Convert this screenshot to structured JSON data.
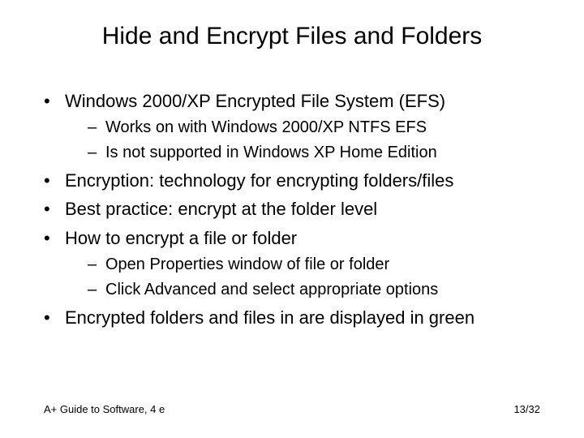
{
  "title": "Hide and Encrypt Files and Folders",
  "bullets": [
    {
      "text": "Windows 2000/XP Encrypted File System (EFS)",
      "sub": [
        "Works on with Windows 2000/XP NTFS EFS",
        "Is not supported in Windows XP Home Edition"
      ]
    },
    {
      "text": "Encryption: technology for encrypting folders/files",
      "sub": []
    },
    {
      "text": "Best practice: encrypt at the folder level",
      "sub": []
    },
    {
      "text": "How to encrypt a file or folder",
      "sub": [
        "Open Properties window of file or folder",
        "Click Advanced and select appropriate options"
      ]
    },
    {
      "text": "Encrypted folders and files in are displayed in green",
      "sub": []
    }
  ],
  "footer": {
    "left": "A+ Guide to Software, 4 e",
    "right": "13/32"
  }
}
